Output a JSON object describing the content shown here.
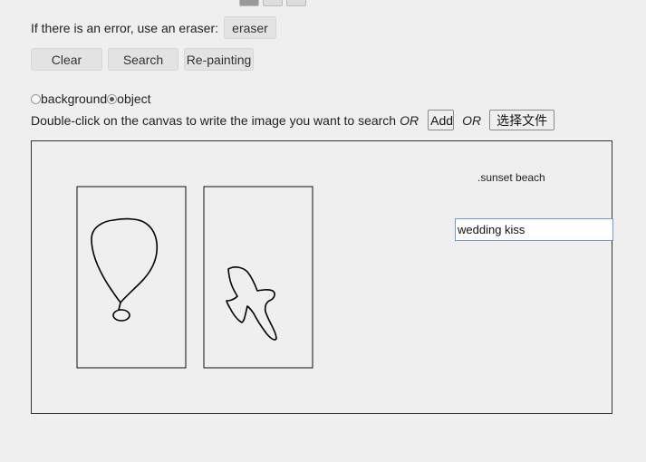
{
  "eraser": {
    "hint": "If there is an error, use an eraser:",
    "button_label": "eraser"
  },
  "actions": {
    "clear_label": "Clear",
    "search_label": "Search",
    "repaint_label": "Re-painting"
  },
  "mode": {
    "options": [
      "background",
      "object"
    ],
    "selected": "object"
  },
  "instructions": {
    "text": "Double-click on the canvas to write the image you want to search",
    "or1": "OR",
    "add_label": "Add",
    "or2": "OR",
    "file_button_label": "选择文件"
  },
  "canvas": {
    "text_label": ".sunset beach",
    "text_input_value": "wedding kiss"
  },
  "icons": {
    "sketch1": "balloon-sketch",
    "sketch2": "bird-sketch"
  }
}
